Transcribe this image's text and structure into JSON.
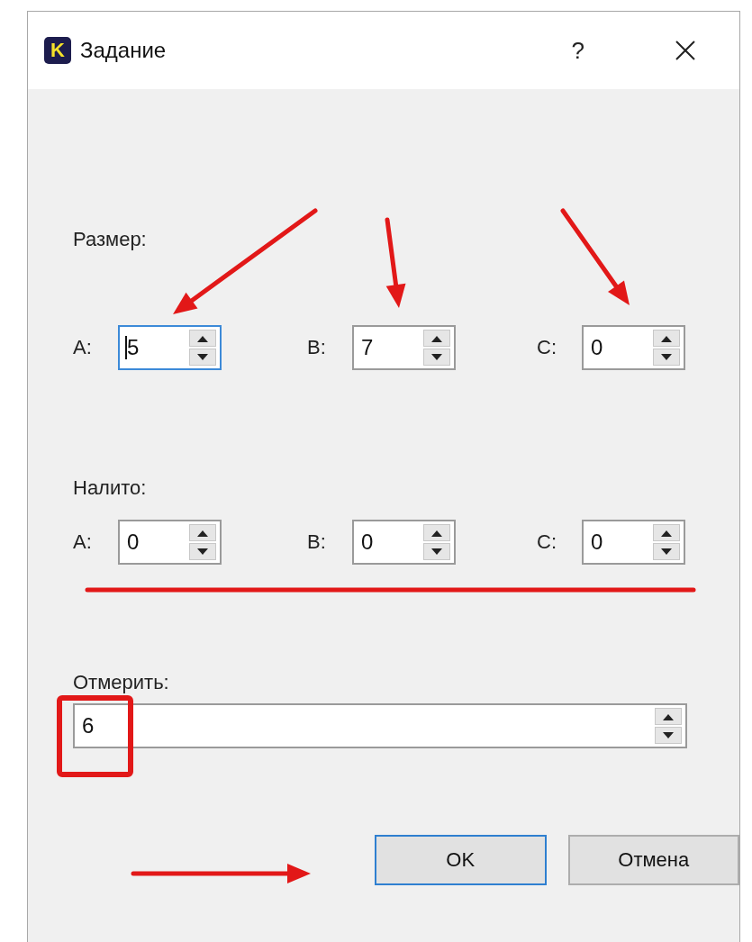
{
  "window": {
    "icon_letter": "K",
    "title": "Задание",
    "help": "?"
  },
  "size": {
    "label": "Размер:",
    "fields": [
      {
        "label": "A:",
        "value": "5",
        "focused": true
      },
      {
        "label": "B:",
        "value": "7",
        "focused": false
      },
      {
        "label": "C:",
        "value": "0",
        "focused": false
      }
    ]
  },
  "filled": {
    "label": "Налито:",
    "fields": [
      {
        "label": "A:",
        "value": "0",
        "focused": false
      },
      {
        "label": "B:",
        "value": "0",
        "focused": false
      },
      {
        "label": "C:",
        "value": "0",
        "focused": false
      }
    ]
  },
  "measure": {
    "label": "Отмерить:",
    "value": "6"
  },
  "buttons": [
    {
      "label": "OK",
      "default": true
    },
    {
      "label": "Отмена",
      "default": false
    }
  ],
  "annotations": [
    {
      "kind": "arrow"
    },
    {
      "kind": "arrow"
    },
    {
      "kind": "arrow"
    },
    {
      "kind": "underline"
    },
    {
      "kind": "frame"
    },
    {
      "kind": "arrow"
    }
  ]
}
